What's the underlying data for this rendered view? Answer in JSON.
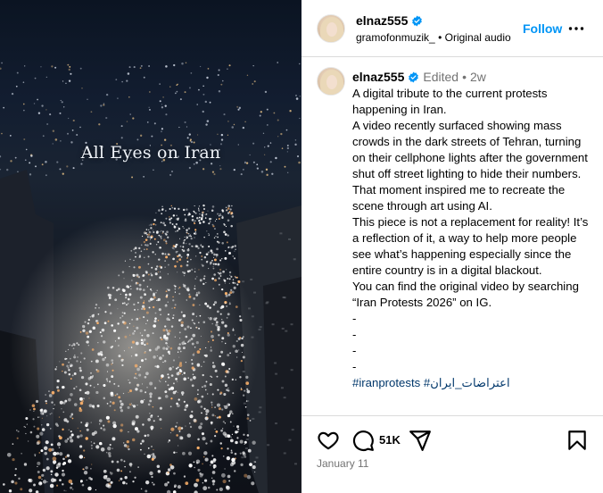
{
  "media": {
    "overlay_text": "All Eyes on Iran"
  },
  "header": {
    "username": "elnaz555",
    "audio_user": "gramofonmuzik_",
    "audio_sep": "•",
    "audio_label": "Original audio",
    "follow_label": "Follow"
  },
  "caption": {
    "username": "elnaz555",
    "edited": "Edited",
    "dot": "•",
    "age": "2w",
    "lines": [
      "A digital tribute to the current protests happening in Iran.",
      "A video recently surfaced showing mass crowds in the dark streets of Tehran, turning on their cellphone lights after the government shut off street lighting to hide their numbers. That moment inspired me to recreate the scene through art using AI.",
      "This piece is not a replacement for reality! It’s a reflection of it, a way to help more people see what’s happening especially since the entire country is in a digital blackout.",
      "You can find the original video by searching “Iran Protests 2026” on IG.",
      "-",
      "-",
      "-",
      "-"
    ],
    "hashtags": "#iranprotests #اعتراضات_ایران"
  },
  "actions": {
    "comment_count": "51K",
    "date": "January 11"
  },
  "colors": {
    "link_blue": "#0095f6",
    "verified_blue": "#0095f6",
    "muted": "#737373",
    "border": "#dbdbdb"
  },
  "icons": [
    "verified-badge-icon",
    "more-options-icon",
    "heart-icon",
    "comment-icon",
    "share-icon",
    "bookmark-icon"
  ]
}
